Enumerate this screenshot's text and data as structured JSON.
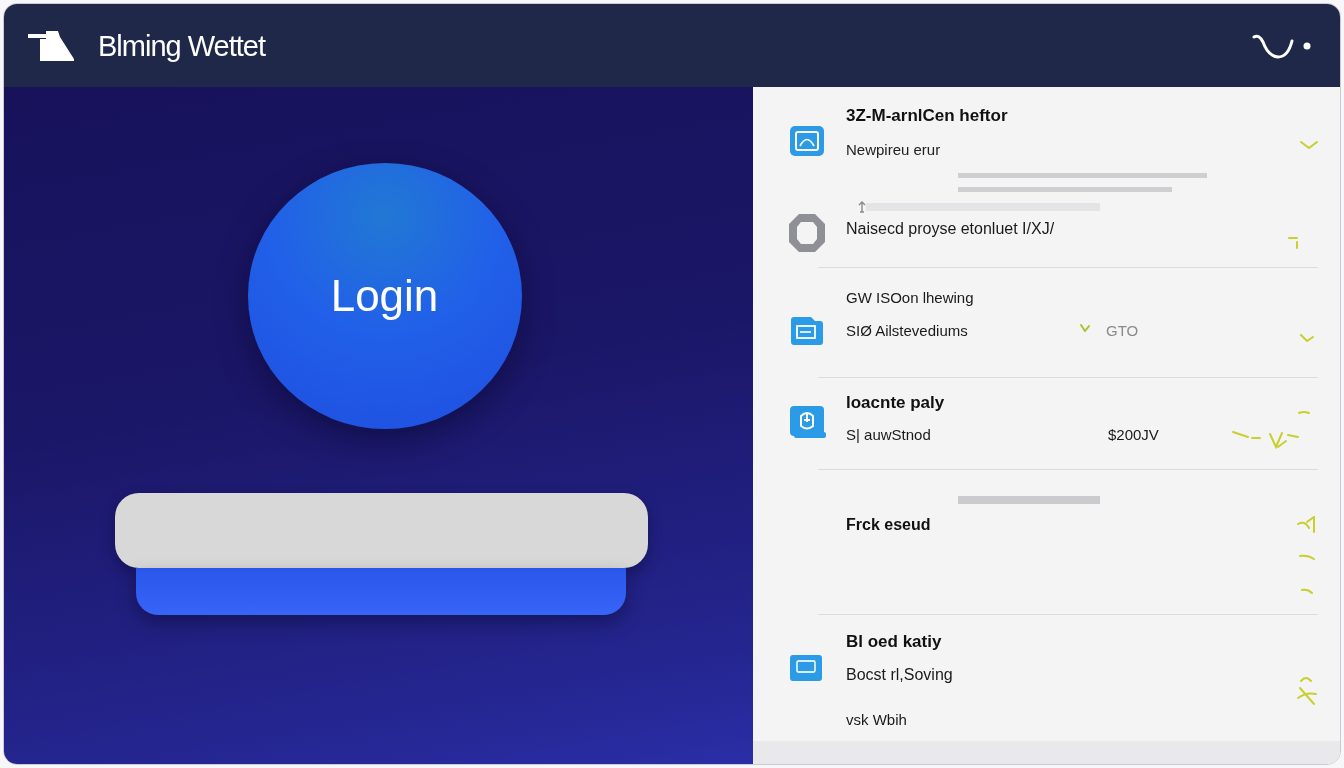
{
  "title_bar": {
    "title": "Blming Wettet"
  },
  "login": {
    "button_label": "Login"
  },
  "list": {
    "groups": [
      {
        "items": [
          {
            "kind": "entry",
            "title": "3Z-M-arnlCen heftor",
            "subtitle": "Newpireu erur"
          },
          {
            "kind": "skeleton"
          },
          {
            "kind": "line",
            "text": "Naisecd proyse etonluet I/XJ/"
          }
        ]
      },
      {
        "items": [
          {
            "kind": "pair",
            "text": "GW ISOon lhewing",
            "detail": "SIØ Ailstevediums",
            "value": "GTO"
          }
        ]
      },
      {
        "items": [
          {
            "kind": "priced",
            "title": "loacnte paly",
            "detail": "S| auwStnod",
            "value": "$200JV"
          }
        ]
      },
      {
        "items": [
          {
            "kind": "heading",
            "title": "Frck eseud"
          }
        ]
      },
      {
        "items": [
          {
            "kind": "card",
            "title": "Bl oed katiy",
            "lines": [
              "Bocst rl,Soving",
              "vsk Wbih"
            ]
          }
        ]
      }
    ]
  }
}
